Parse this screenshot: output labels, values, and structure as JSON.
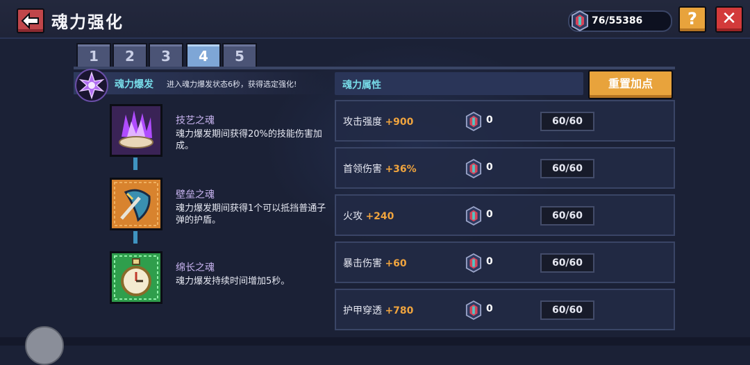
{
  "header": {
    "title": "魂力强化",
    "currency": "76/55386",
    "help_label": "?",
    "close_label": "✕"
  },
  "tabs": [
    {
      "label": "1",
      "active": false
    },
    {
      "label": "2",
      "active": false
    },
    {
      "label": "3",
      "active": false
    },
    {
      "label": "4",
      "active": true
    },
    {
      "label": "5",
      "active": false
    }
  ],
  "burst": {
    "title": "魂力爆发",
    "description": "进入魂力爆发状态6秒，获得选定强化!"
  },
  "skills": [
    {
      "name": "技艺之魂",
      "description": "魂力爆发期间获得20%的技能伤害加成。",
      "icon": "purple-crystal-icon"
    },
    {
      "name": "壁垒之魂",
      "description": "魂力爆发期间获得1个可以抵挡普通子弹的护盾。",
      "icon": "shield-icon"
    },
    {
      "name": "绵长之魂",
      "description": "魂力爆发持续时间增加5秒。",
      "icon": "stopwatch-icon"
    }
  ],
  "attributes_header": "魂力属性",
  "reset_label": "重置加点",
  "attributes": [
    {
      "name": "攻击强度",
      "bonus": "+900",
      "count": "0",
      "level": "60/60"
    },
    {
      "name": "首领伤害",
      "bonus": "+36%",
      "count": "0",
      "level": "60/60"
    },
    {
      "name": "火攻",
      "bonus": "+240",
      "count": "0",
      "level": "60/60"
    },
    {
      "name": "暴击伤害",
      "bonus": "+60",
      "count": "0",
      "level": "60/60"
    },
    {
      "name": "护甲穿透",
      "bonus": "+780",
      "count": "0",
      "level": "60/60"
    }
  ],
  "colors": {
    "accent_cyan": "#77dbe8",
    "bonus_orange": "#f0a43e",
    "button_orange": "#e8a33c",
    "close_red": "#d33a3a",
    "active_tab": "#7ea6d6"
  }
}
